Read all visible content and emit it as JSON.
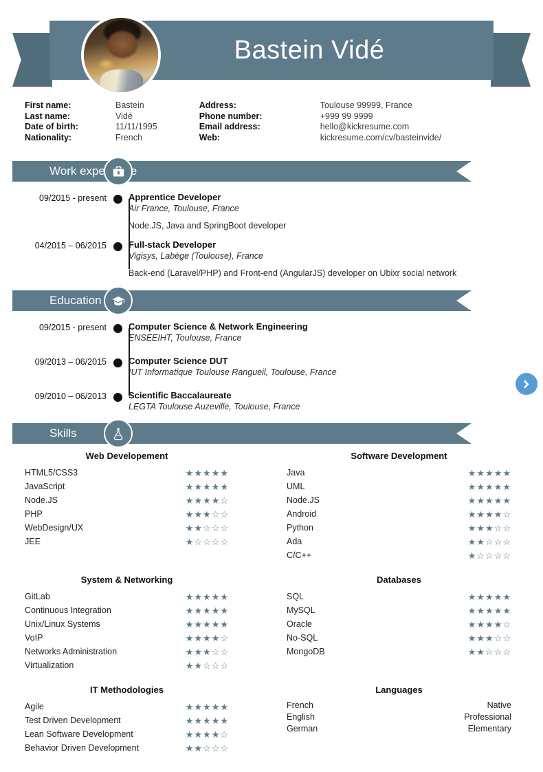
{
  "header": {
    "full_name": "Bastein Vidé",
    "avatar_alt": "profile-photo"
  },
  "contact": {
    "left": {
      "labels": [
        "First name:",
        "Last name:",
        "Date of birth:",
        "Nationality:"
      ],
      "values": [
        "Bastein",
        "Vidé",
        "11/11/1995",
        "French"
      ]
    },
    "right": {
      "labels": [
        "Address:",
        "Phone number:",
        "Email address:",
        "Web:"
      ],
      "values": [
        "Toulouse 99999, France",
        "+999 99 9999",
        "hello@kickresume.com",
        "kickresume.com/cv/basteinvide/"
      ]
    }
  },
  "sections": {
    "work": {
      "title": "Work experience",
      "icon": "briefcase-icon",
      "items": [
        {
          "date": "09/2015 - present",
          "title": "Apprentice Developer",
          "subtitle": "Air France, Toulouse, France",
          "description": "Node.JS, Java and SpringBoot developer"
        },
        {
          "date": "04/2015 – 06/2015",
          "title": "Full-stack Developer",
          "subtitle": "Vigisys, Labège (Toulouse), France",
          "description": "Back-end (Laravel/PHP) and Front-end (AngularJS) developer on Ubixr social network"
        }
      ]
    },
    "education": {
      "title": "Education",
      "icon": "graduation-cap-icon",
      "items": [
        {
          "date": "09/2015 - present",
          "title": "Computer Science & Network Engineering",
          "subtitle": "ENSEEIHT, Toulouse, France",
          "description": ""
        },
        {
          "date": "09/2013 – 06/2015",
          "title": "Computer Science DUT",
          "subtitle": "IUT Informatique Toulouse Rangueil, Toulouse, France",
          "description": ""
        },
        {
          "date": "09/2010 – 06/2013",
          "title": "Scientific Baccalaureate",
          "subtitle": "LEGTA Toulouse Auzeville, Toulouse, France",
          "description": ""
        }
      ]
    },
    "skills": {
      "title": "Skills",
      "icon": "flask-icon",
      "groups": [
        {
          "heading": "Web Developement",
          "rows": [
            {
              "name": "HTML5/CSS3",
              "rating": 5
            },
            {
              "name": "JavaScript",
              "rating": 5
            },
            {
              "name": "Node.JS",
              "rating": 4
            },
            {
              "name": "PHP",
              "rating": 3
            },
            {
              "name": "WebDesign/UX",
              "rating": 2
            },
            {
              "name": "JEE",
              "rating": 1
            }
          ]
        },
        {
          "heading": "Software Development",
          "rows": [
            {
              "name": "Java",
              "rating": 5
            },
            {
              "name": "UML",
              "rating": 5
            },
            {
              "name": "Node.JS",
              "rating": 5
            },
            {
              "name": "Android",
              "rating": 4
            },
            {
              "name": "Python",
              "rating": 3
            },
            {
              "name": "Ada",
              "rating": 2
            },
            {
              "name": "C/C++",
              "rating": 1
            }
          ]
        },
        {
          "heading": "System & Networking",
          "rows": [
            {
              "name": "GitLab",
              "rating": 5
            },
            {
              "name": "Continuous Integration",
              "rating": 5
            },
            {
              "name": "Unix/Linux Systems",
              "rating": 5
            },
            {
              "name": "VoIP",
              "rating": 4
            },
            {
              "name": "Networks Administration",
              "rating": 3
            },
            {
              "name": "Virtualization",
              "rating": 2
            }
          ]
        },
        {
          "heading": "Databases",
          "rows": [
            {
              "name": "SQL",
              "rating": 5
            },
            {
              "name": "MySQL",
              "rating": 5
            },
            {
              "name": "Oracle",
              "rating": 4
            },
            {
              "name": "No-SQL",
              "rating": 3
            },
            {
              "name": "MongoDB",
              "rating": 2
            }
          ]
        },
        {
          "heading": "IT Methodologies",
          "rows": [
            {
              "name": "Agile",
              "rating": 5
            },
            {
              "name": "Test Driven Development",
              "rating": 5
            },
            {
              "name": "Lean Software Development",
              "rating": 4
            },
            {
              "name": "Behavior Driven Development",
              "rating": 2
            }
          ]
        },
        {
          "heading": "Languages",
          "languages": [
            {
              "name": "French",
              "level": "Native"
            },
            {
              "name": "English",
              "level": "Professional"
            },
            {
              "name": "German",
              "level": "Elementary"
            }
          ]
        }
      ]
    }
  },
  "nav": {
    "next_icon": "chevron-right-icon"
  },
  "colors": {
    "slate": "#5d7b8a",
    "slate_dark": "#4f6d7a",
    "star": "#5d7b8a",
    "accent_blue": "#5b9bd5"
  }
}
